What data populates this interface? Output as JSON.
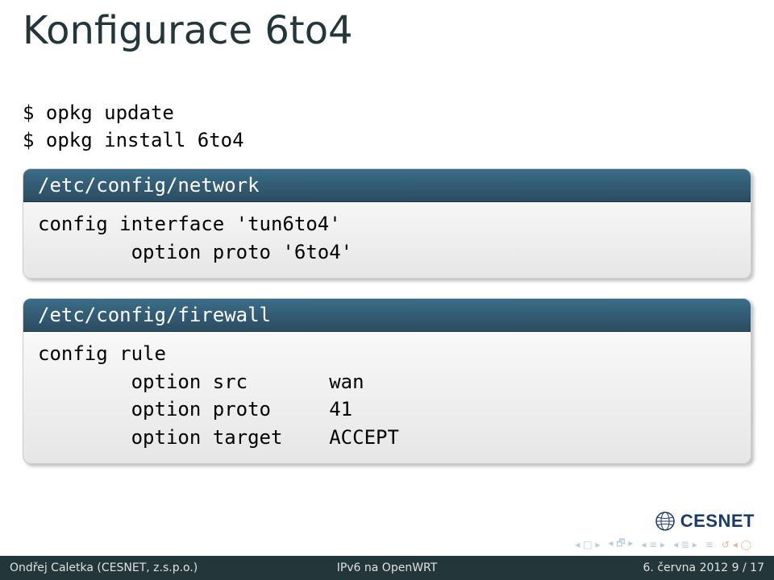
{
  "title": "Konfigurace 6to4",
  "commands": {
    "line1": "$ opkg update",
    "line2": "$ opkg install 6to4"
  },
  "box1": {
    "header": "/etc/config/network",
    "body": "config interface 'tun6to4'\n        option proto '6to4'"
  },
  "box2": {
    "header": "/etc/config/firewall",
    "body": "config rule\n        option src       wan\n        option proto     41\n        option target    ACCEPT"
  },
  "logo_text": "CESNET",
  "footer": {
    "left": "Ondřej Caletka (CESNET, z.s.p.o.)",
    "center": "IPv6 na OpenWRT",
    "right": "6. června 2012     9 / 17"
  }
}
